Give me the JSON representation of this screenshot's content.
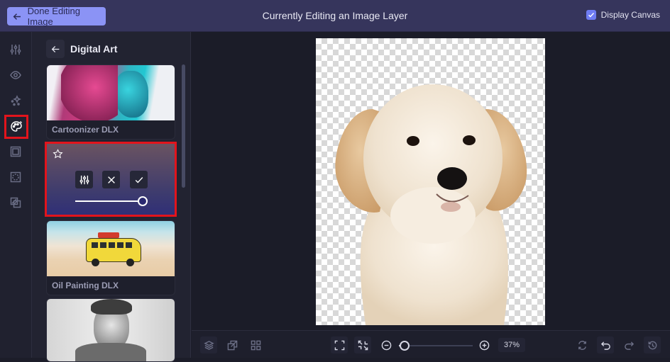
{
  "header": {
    "done_button": "Done Editing Image",
    "title": "Currently Editing an Image Layer",
    "display_canvas_label": "Display Canvas",
    "display_canvas_checked": true
  },
  "rail": {
    "items": [
      {
        "name": "adjustments",
        "icon": "sliders-icon",
        "active": false
      },
      {
        "name": "view",
        "icon": "eye-icon",
        "active": false
      },
      {
        "name": "effects",
        "icon": "sparkles-icon",
        "active": false
      },
      {
        "name": "artistic",
        "icon": "palette-icon",
        "active": true
      },
      {
        "name": "frames",
        "icon": "frame-icon",
        "active": false
      },
      {
        "name": "vignette",
        "icon": "vignette-icon",
        "active": false
      },
      {
        "name": "overlays",
        "icon": "overlay-icon",
        "active": false
      }
    ]
  },
  "panel": {
    "title": "Digital Art",
    "cards": [
      {
        "label": "Cartoonizer DLX"
      },
      {
        "label": "Oil Painting DLX"
      },
      {
        "label": ""
      }
    ],
    "active_card": {
      "favorite_icon": "star-icon",
      "intensity": 1.0
    }
  },
  "bottom_bar": {
    "zoom_value": "37%",
    "zoom_slider_fraction": 0.06
  },
  "colors": {
    "accent": "#8b93f5",
    "header_bg": "#36355c",
    "highlight": "#e2141c"
  }
}
